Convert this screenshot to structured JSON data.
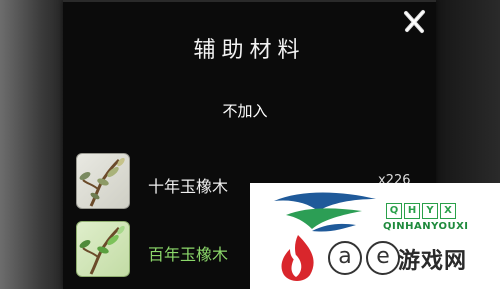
{
  "dialog": {
    "title": "辅助材料",
    "no_add_label": "不加入",
    "close_icon": "close-x-icon"
  },
  "items": [
    {
      "name": "十年玉橡木",
      "count": "x226",
      "icon": "jade-oak-branch-icon",
      "rarity_color": "#efefef"
    },
    {
      "name": "百年玉橡木",
      "count": "",
      "icon": "jade-oak-branch-icon",
      "rarity_color": "#8bd76a"
    }
  ],
  "watermark": {
    "brand_letters": [
      "Q",
      "H",
      "Y",
      "X"
    ],
    "subtitle": "QINHANYOUXI",
    "circled_letters": [
      "a",
      "e"
    ],
    "site_name": "游戏网"
  }
}
